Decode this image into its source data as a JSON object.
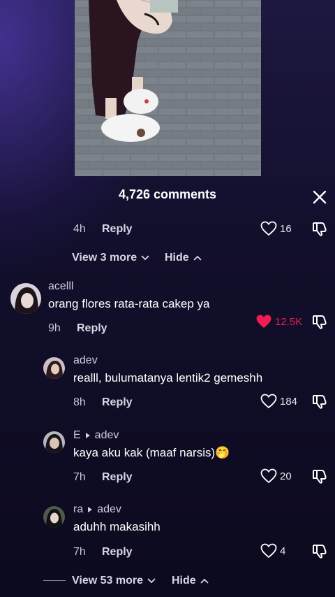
{
  "header": {
    "comments_count": "4,726 comments"
  },
  "prior_reply": {
    "time": "4h",
    "reply_label": "Reply",
    "likes": "16"
  },
  "view_more_1": {
    "label": "View 3 more",
    "hide_label": "Hide"
  },
  "comments": [
    {
      "username": "acelll",
      "text": "orang flores rata-rata cakep ya",
      "time": "9h",
      "reply_label": "Reply",
      "likes": "12.5K",
      "liked": true
    },
    {
      "username": "adev",
      "text": "realll, bulumatanya lentik2 gemeshh",
      "time": "8h",
      "reply_label": "Reply",
      "likes": "184"
    },
    {
      "username": "E",
      "reply_to": "adev",
      "text": "kaya aku kak (maaf narsis)",
      "emoji": "🤭",
      "time": "7h",
      "reply_label": "Reply",
      "likes": "20"
    },
    {
      "username": "ra",
      "reply_to": "adev",
      "text": "aduhh makasihh",
      "time": "7h",
      "reply_label": "Reply",
      "likes": "4"
    }
  ],
  "view_more_2": {
    "label": "View 53 more",
    "hide_label": "Hide"
  },
  "colors": {
    "liked_heart": "#ee1d52",
    "background": "#0c0a1c"
  }
}
